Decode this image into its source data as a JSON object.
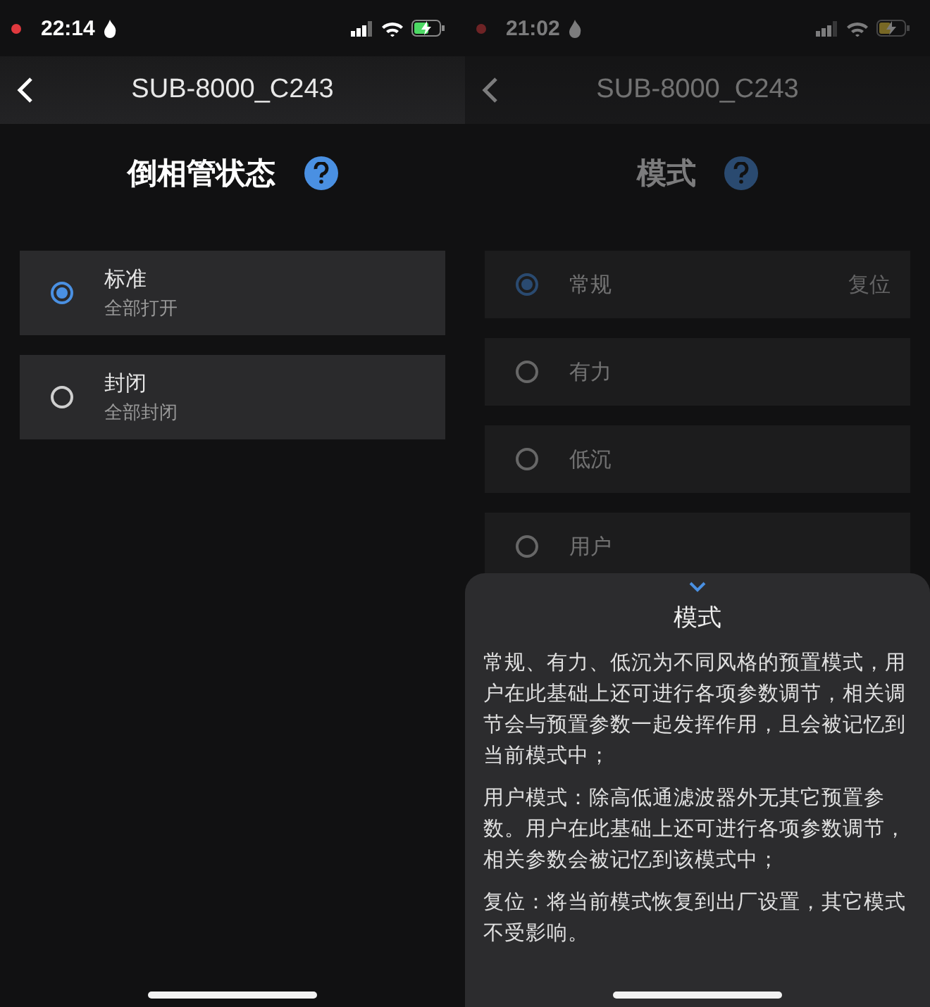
{
  "screens": [
    {
      "dimmed": false,
      "status_bar": {
        "time": "22:14"
      },
      "nav": {
        "title": "SUB-8000_C243"
      },
      "heading": "倒相管状态",
      "options": [
        {
          "label": "标准",
          "sublabel": "全部打开",
          "selected": true
        },
        {
          "label": "封闭",
          "sublabel": "全部封闭",
          "selected": false
        }
      ]
    },
    {
      "dimmed": true,
      "status_bar": {
        "time": "21:02"
      },
      "nav": {
        "title": "SUB-8000_C243"
      },
      "heading": "模式",
      "options": [
        {
          "label": "常规",
          "action": "复位",
          "selected": true
        },
        {
          "label": "有力",
          "selected": false
        },
        {
          "label": "低沉",
          "selected": false
        },
        {
          "label": "用户",
          "selected": false
        }
      ],
      "sheet": {
        "title": "模式",
        "paragraphs": [
          "常规、有力、低沉为不同风格的预置模式，用户在此基础上还可进行各项参数调节，相关调节会与预置参数一起发挥作用，且会被记忆到当前模式中；",
          "用户模式：除高低通滤波器外无其它预置参数。用户在此基础上还可进行各项参数调节，相关参数会被记忆到该模式中；",
          "复位：将当前模式恢复到出厂设置，其它模式不受影响。"
        ]
      }
    }
  ]
}
